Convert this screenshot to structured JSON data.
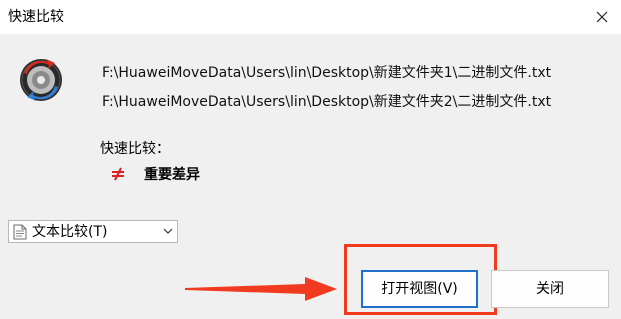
{
  "window": {
    "title": "快速比较"
  },
  "files": {
    "path1": "F:\\HuaweiMoveData\\Users\\lin\\Desktop\\新建文件夹1\\二进制文件.txt",
    "path2": "F:\\HuaweiMoveData\\Users\\lin\\Desktop\\新建文件夹2\\二进制文件.txt"
  },
  "result": {
    "label": "快速比较：",
    "status_text": "重要差异",
    "status_icon": "not-equal-icon",
    "status_color": "#e02020"
  },
  "compare_mode": {
    "selected": "文本比较(T)",
    "icon": "text-document-icon"
  },
  "buttons": {
    "open_view": "打开视图(V)",
    "close": "关闭"
  },
  "annotation": {
    "color": "#f03b20"
  }
}
